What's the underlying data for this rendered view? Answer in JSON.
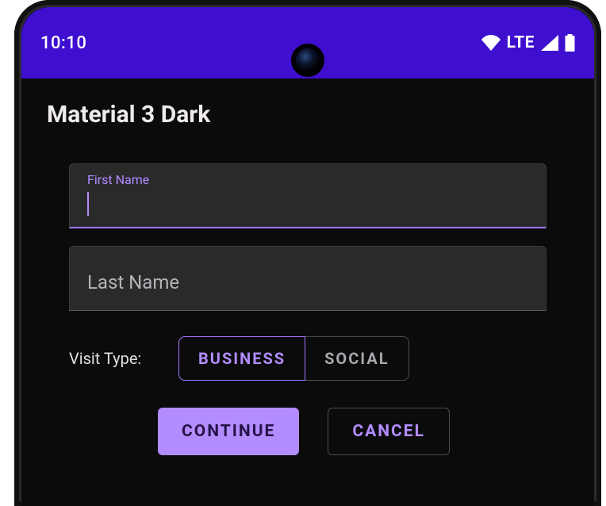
{
  "status": {
    "time": "10:10",
    "network": "LTE"
  },
  "page": {
    "title": "Material 3 Dark"
  },
  "form": {
    "first_name": {
      "label": "First Name",
      "value": ""
    },
    "last_name": {
      "label": "Last Name",
      "value": ""
    },
    "visit_type": {
      "label": "Visit Type:",
      "options": [
        "BUSINESS",
        "SOCIAL"
      ],
      "selected": "BUSINESS"
    }
  },
  "buttons": {
    "continue": "CONTINUE",
    "cancel": "CANCEL"
  },
  "colors": {
    "primary": "#b38cff",
    "status_bg": "#3f0fcf",
    "surface": "#0b0b0c"
  }
}
